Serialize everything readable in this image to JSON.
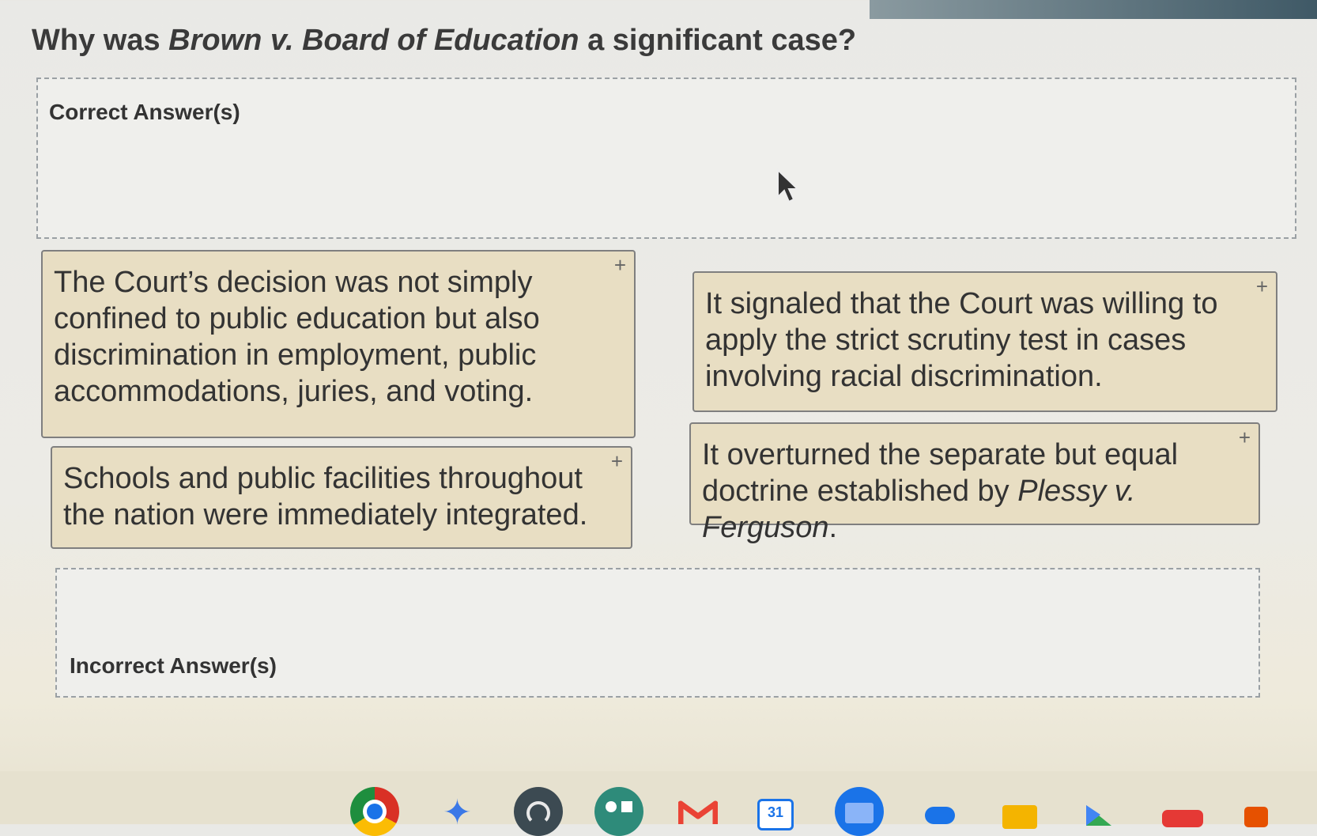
{
  "question": {
    "prefix": "Why was ",
    "case_name": "Brown v. Board of Education",
    "suffix": " a significant case?"
  },
  "correct_zone": {
    "label": "Correct Answer(s)"
  },
  "incorrect_zone": {
    "label": "Incorrect Answer(s)"
  },
  "cards": [
    {
      "text": "The Court’s decision was not simply confined to public education but also discrimination in employment, public accommodations, juries, and voting."
    },
    {
      "text": "It signaled that the Court was willing to apply the strict scrutiny test in cases involving racial discrimination."
    },
    {
      "text": "Schools and public facilities throughout the nation were immediately integrated."
    },
    {
      "text_before": "It overturned the separate but equal doctrine established by ",
      "italic": "Plessy v. Ferguson",
      "text_after": "."
    }
  ],
  "drag_handle_glyph": "+",
  "taskbar": {
    "icons": [
      "chrome-icon",
      "gemini-icon",
      "classroom-icon",
      "apps-icon",
      "gmail-icon",
      "calendar-icon",
      "files-icon",
      "chat-icon",
      "slides-icon",
      "play-store-icon",
      "youtube-icon",
      "more-icon"
    ],
    "calendar_day": "31"
  },
  "colors": {
    "card_bg": "#e8dec3",
    "card_border": "#7f7f7f",
    "zone_border": "#9aa0a4"
  }
}
